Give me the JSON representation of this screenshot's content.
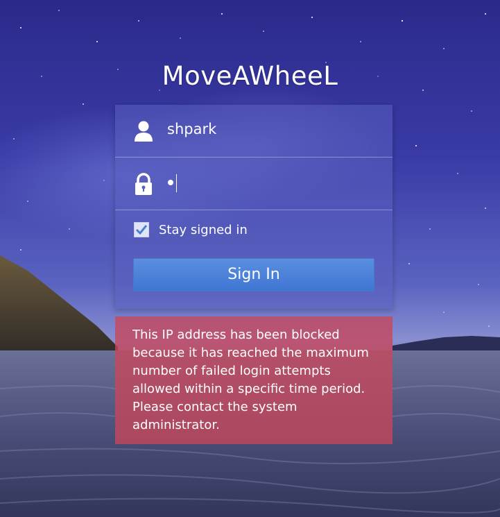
{
  "app": {
    "title": "MoveAWheeL"
  },
  "login": {
    "username_value": "shpark",
    "password_masked": "•",
    "stay_signed_in_label": "Stay signed in",
    "stay_signed_in_checked": true,
    "sign_in_label": "Sign In"
  },
  "icons": {
    "user": "user-icon",
    "lock": "lock-icon",
    "check": "checkmark-icon"
  },
  "error": {
    "message": "This IP address has been blocked because it has reached the maximum number of failed login attempts allowed within a specific time period. Please contact the system administrator."
  },
  "colors": {
    "sign_in_button": "#4a80d8",
    "error_background": "#c8465a",
    "panel_background": "#5a5fbe"
  }
}
